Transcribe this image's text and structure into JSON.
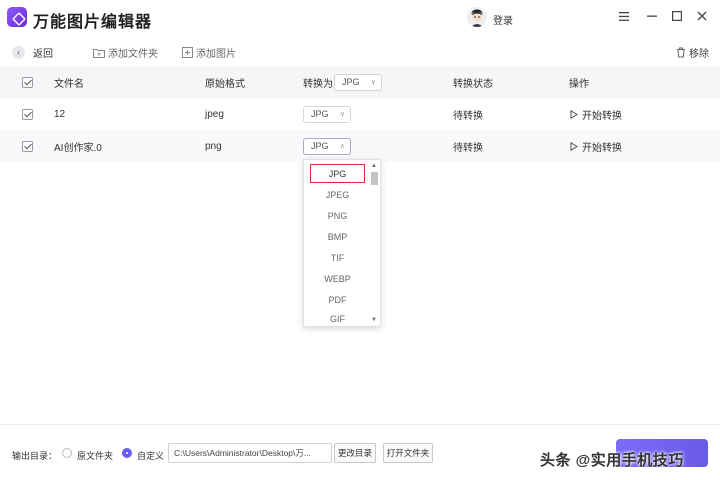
{
  "app": {
    "title": "万能图片编辑器",
    "login_label": "登录"
  },
  "toolbar": {
    "back_label": "返回",
    "add_folder_label": "添加文件夹",
    "add_image_label": "添加图片",
    "remove_label": "移除"
  },
  "table": {
    "headers": {
      "filename": "文件名",
      "original_format": "原始格式",
      "convert_to": "转换为",
      "convert_to_value": "JPG",
      "status": "转换状态",
      "action": "操作"
    },
    "rows": [
      {
        "filename": "12",
        "original_format": "jpeg",
        "convert_to": "JPG",
        "status": "待转换",
        "action": "开始转换",
        "checked": true
      },
      {
        "filename": "AI创作家.0",
        "original_format": "png",
        "convert_to": "JPG",
        "status": "待转换",
        "action": "开始转换",
        "checked": true
      }
    ]
  },
  "dropdown": {
    "options": [
      "JPG",
      "JPEG",
      "PNG",
      "BMP",
      "TIF",
      "WEBP",
      "PDF",
      "GIF"
    ],
    "selected": "JPG"
  },
  "footer": {
    "output_label": "输出目录：",
    "option_original": "原文件夹",
    "option_custom": "自定义",
    "path_value": "C:\\Users\\Administrator\\Desktop\\万...",
    "change_dir_label": "更改目录",
    "open_folder_label": "打开文件夹"
  },
  "watermark": "头条 @实用手机技巧",
  "colors": {
    "accent": "#6a5cf0",
    "selected_border": "#d03030"
  }
}
